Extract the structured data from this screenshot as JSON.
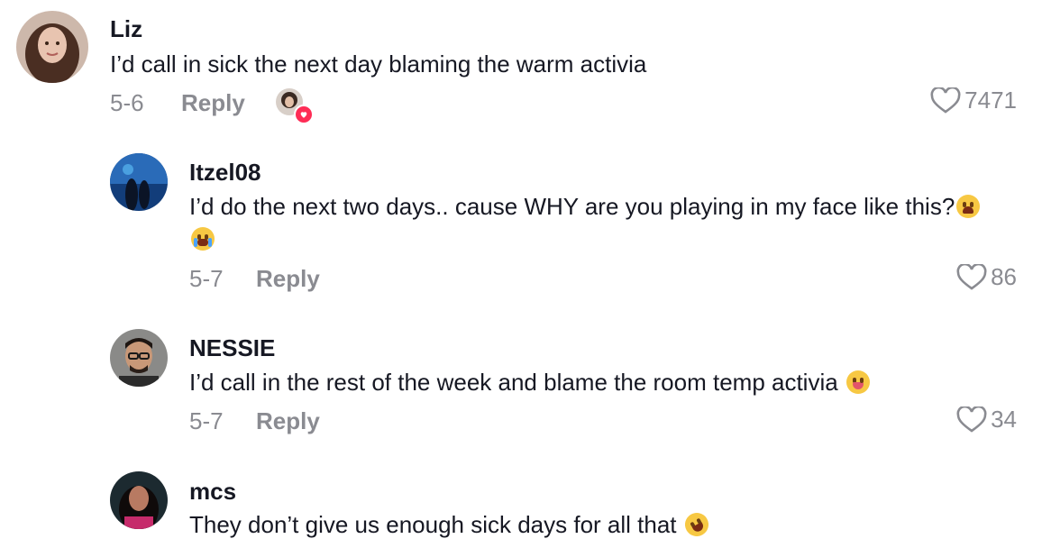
{
  "comments": [
    {
      "username": "Liz",
      "text": "I’d call in sick the next day blaming the warm activia",
      "date": "5-6",
      "reply_label": "Reply",
      "likes": "7471",
      "liked_by_creator": true
    },
    {
      "username": "Itzel08",
      "text": "I’d do the next two days.. cause WHY are you playing in my face like this?",
      "date": "5-7",
      "reply_label": "Reply",
      "likes": "86",
      "emojis": [
        "weary-face-emoji",
        "loudly-crying-face-emoji"
      ]
    },
    {
      "username": "NESSIE",
      "text": "I’d call in the rest of the week and blame the room temp activia",
      "date": "5-7",
      "reply_label": "Reply",
      "likes": "34",
      "emojis": [
        "squinting-face-with-tongue-emoji"
      ]
    },
    {
      "username": "mcs",
      "text": "They don’t give us enough sick days for all that",
      "emojis": [
        "rolling-on-the-floor-laughing-emoji"
      ]
    }
  ],
  "colors": {
    "primary_text": "#161823",
    "secondary_text": "#8a8b91",
    "like_badge": "#fe2c55"
  }
}
